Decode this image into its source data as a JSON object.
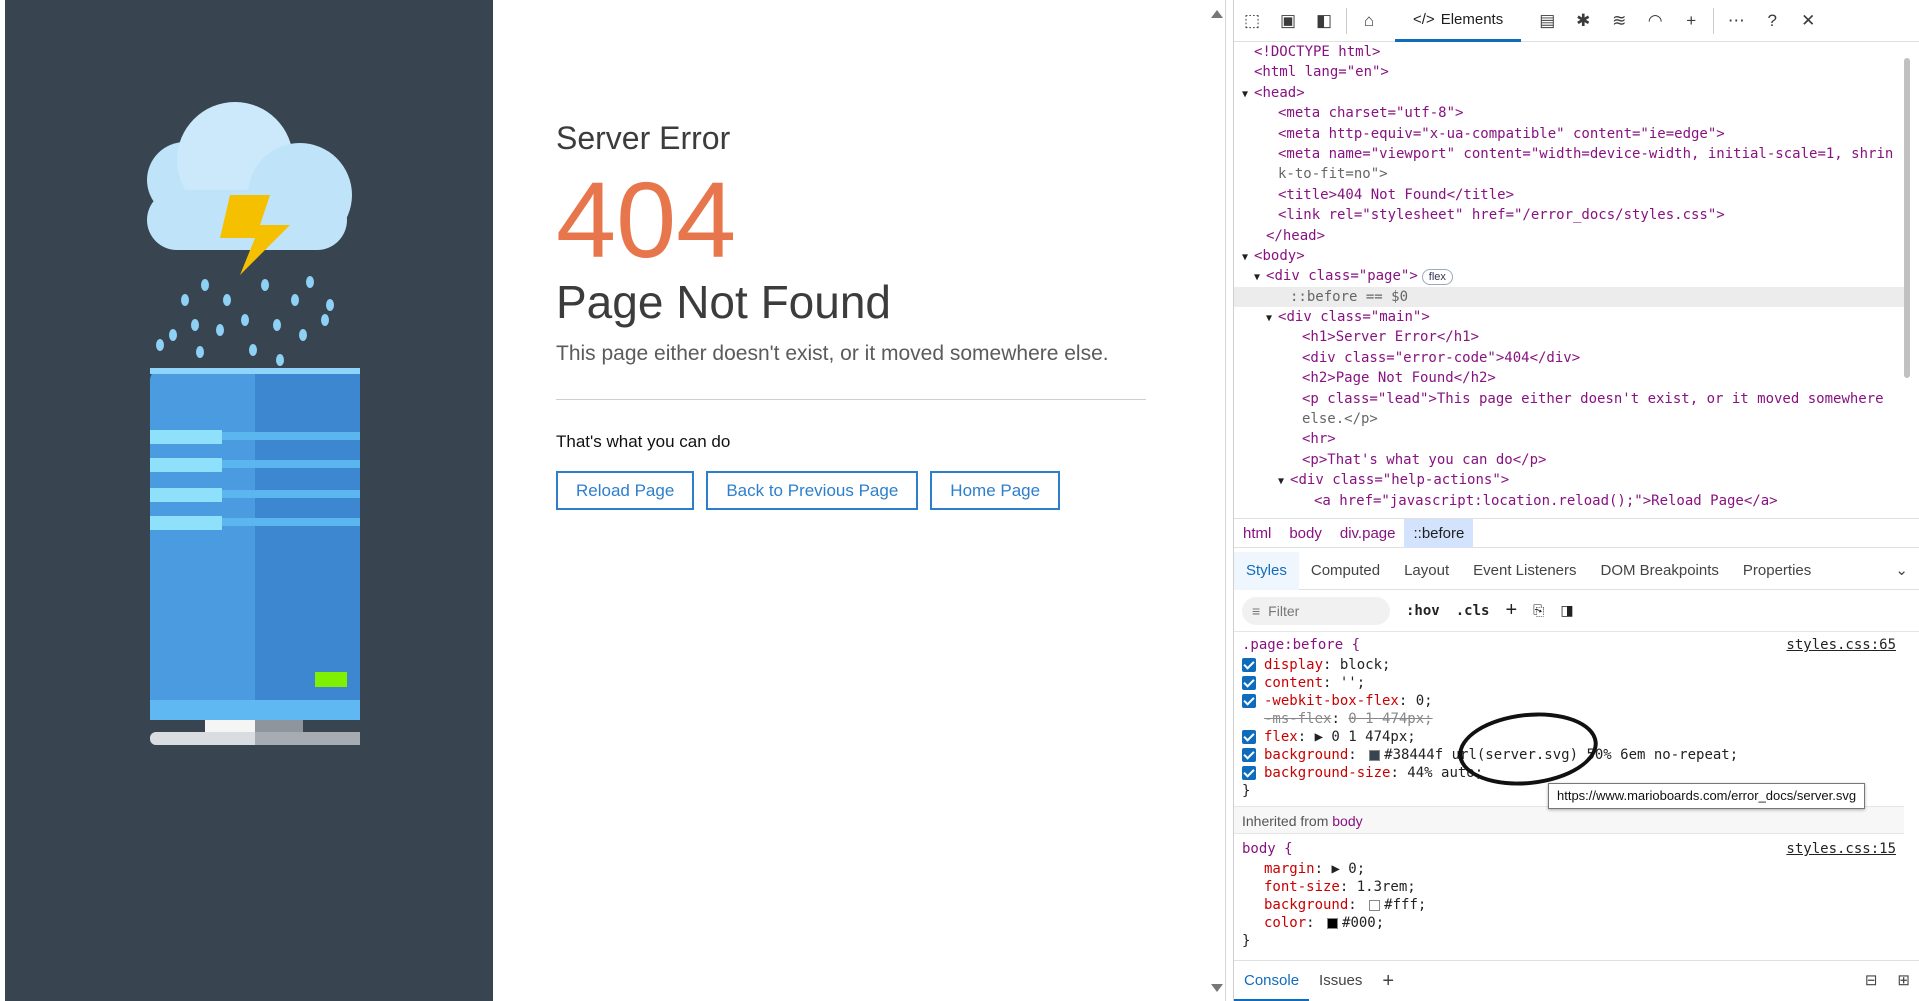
{
  "page": {
    "h1": "Server Error",
    "error_code": "404",
    "h2": "Page Not Found",
    "lead": "This page either doesn't exist, or it moved somewhere else.",
    "todo": "That's what you can do",
    "actions": [
      "Reload Page",
      "Back to Previous Page",
      "Home Page"
    ],
    "art_bg": "#38444f",
    "accent": "#e7764c",
    "link_color": "#2d7fcc"
  },
  "devtools": {
    "toolbar": {
      "active_tab": "Elements",
      "icons": [
        "inspect-icon",
        "device-icon",
        "dock-side-icon",
        "welcome-icon",
        "elements-icon",
        "console-icon",
        "sources-icon",
        "network-icon",
        "performance-icon",
        "add-tab-icon",
        "more-icon",
        "help-icon",
        "close-icon"
      ]
    },
    "tree": [
      {
        "indent": 1,
        "html": "<span class='cm'>&lt;!DOCTYPE html&gt;</span>",
        "text": "<!DOCTYPE html>"
      },
      {
        "indent": 1,
        "text": "<html lang=\"en\">"
      },
      {
        "indent": 1,
        "arrow": "open",
        "text": "<head>"
      },
      {
        "indent": 3,
        "text": "<meta charset=\"utf-8\">"
      },
      {
        "indent": 3,
        "text": "<meta http-equiv=\"x-ua-compatible\" content=\"ie=edge\">"
      },
      {
        "indent": 3,
        "text": "<meta name=\"viewport\" content=\"width=device-width, initial-scale=1, shrin"
      },
      {
        "indent": 3,
        "text": "k-to-fit=no\">"
      },
      {
        "indent": 3,
        "text": "<title>404 Not Found</title>"
      },
      {
        "indent": 3,
        "text": "<link rel=\"stylesheet\" href=\"/error_docs/styles.css\">"
      },
      {
        "indent": 2,
        "text": "</head>"
      },
      {
        "indent": 1,
        "arrow": "open",
        "text": "<body>"
      },
      {
        "indent": 2,
        "arrow": "open",
        "text": "<div class=\"page\">",
        "badge": "flex"
      },
      {
        "indent": 4,
        "text": "::before == $0",
        "selected": true
      },
      {
        "indent": 3,
        "arrow": "open",
        "text": "<div class=\"main\">"
      },
      {
        "indent": 5,
        "text": "<h1>Server Error</h1>"
      },
      {
        "indent": 5,
        "text": "<div class=\"error-code\">404</div>"
      },
      {
        "indent": 5,
        "text": "<h2>Page Not Found</h2>"
      },
      {
        "indent": 5,
        "text": "<p class=\"lead\">This page either doesn't exist, or it moved somewhere"
      },
      {
        "indent": 5,
        "text": "else.</p>"
      },
      {
        "indent": 5,
        "text": "<hr>"
      },
      {
        "indent": 5,
        "text": "<p>That's what you can do</p>"
      },
      {
        "indent": 4,
        "arrow": "open",
        "text": "<div class=\"help-actions\">"
      },
      {
        "indent": 6,
        "text": "<a href=\"javascript:location.reload();\">Reload Page</a>"
      }
    ],
    "breadcrumbs": [
      "html",
      "body",
      "div.page",
      "::before"
    ],
    "subtabs": [
      "Styles",
      "Computed",
      "Layout",
      "Event Listeners",
      "DOM Breakpoints",
      "Properties"
    ],
    "styles_toolbar": {
      "filter_placeholder": "Filter",
      "hov": ":hov",
      "cls": ".cls"
    },
    "rule1": {
      "selector": ".page:before {",
      "source": "styles.css:65",
      "decls": [
        {
          "name": "display",
          "value": "block;",
          "checked": true
        },
        {
          "name": "content",
          "value": "'';",
          "checked": true
        },
        {
          "name": "-webkit-box-flex",
          "value": "0;",
          "checked": true
        },
        {
          "name": "-ms-flex",
          "value": "0 1 474px;",
          "checked": false,
          "strike": true
        },
        {
          "name": "flex",
          "value": "▶ 0 1 474px;",
          "checked": true
        },
        {
          "name": "background",
          "value": "#38444f url(server.svg) 50% 6em no-repeat;",
          "checked": true,
          "swatch": "#38444f"
        },
        {
          "name": "background-size",
          "value": "44% auto;",
          "checked": true
        }
      ],
      "close": "}"
    },
    "tooltip": "https://www.marioboards.com/error_docs/server.svg",
    "inherited_label": "Inherited from",
    "inherited_from": "body",
    "rule2": {
      "selector": "body {",
      "source": "styles.css:15",
      "decls": [
        {
          "name": "margin",
          "value": "▶ 0;"
        },
        {
          "name": "font-size",
          "value": "1.3rem;"
        },
        {
          "name": "background",
          "value": "#fff;",
          "swatch": "#ffffff"
        },
        {
          "name": "color",
          "value": "#000;",
          "swatch": "#000000"
        }
      ],
      "close": "}"
    },
    "drawer_tabs": [
      "Console",
      "Issues"
    ]
  }
}
